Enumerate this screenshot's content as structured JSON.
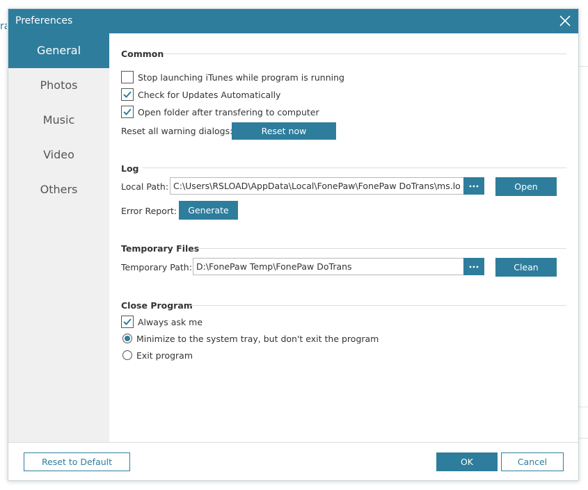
{
  "window": {
    "title": "Preferences"
  },
  "sidebar": {
    "items": [
      {
        "label": "General",
        "active": true
      },
      {
        "label": "Photos"
      },
      {
        "label": "Music"
      },
      {
        "label": "Video"
      },
      {
        "label": "Others"
      }
    ]
  },
  "common": {
    "title": "Common",
    "stop_itunes": {
      "label": "Stop launching iTunes while program is running",
      "checked": false
    },
    "check_updates": {
      "label": "Check for Updates Automatically",
      "checked": true
    },
    "open_folder": {
      "label": "Open folder after transfering to computer",
      "checked": true
    },
    "reset_warning_label": "Reset all warning dialogs:",
    "reset_now_label": "Reset now"
  },
  "log": {
    "title": "Log",
    "local_path_label": "Local Path:",
    "local_path_value": "C:\\Users\\RSLOAD\\AppData\\Local\\FonePaw\\FonePaw DoTrans\\ms.log",
    "open_label": "Open",
    "error_report_label": "Error Report:",
    "generate_label": "Generate"
  },
  "temp": {
    "title": "Temporary Files",
    "path_label": "Temporary Path:",
    "path_value": "D:\\FonePaw Temp\\FonePaw DoTrans",
    "clean_label": "Clean"
  },
  "close_program": {
    "title": "Close Program",
    "always_ask": {
      "label": "Always ask me",
      "checked": true
    },
    "minimize": {
      "label": "Minimize to the system tray, but don't exit the program",
      "selected": true
    },
    "exit": {
      "label": "Exit program",
      "selected": false
    }
  },
  "footer": {
    "reset_default_label": "Reset to Default",
    "ok_label": "OK",
    "cancel_label": "Cancel"
  },
  "background": {
    "partial_text": "ra"
  },
  "colors": {
    "accent": "#2e7d9c",
    "sidebar_bg": "#f0f0f0"
  }
}
